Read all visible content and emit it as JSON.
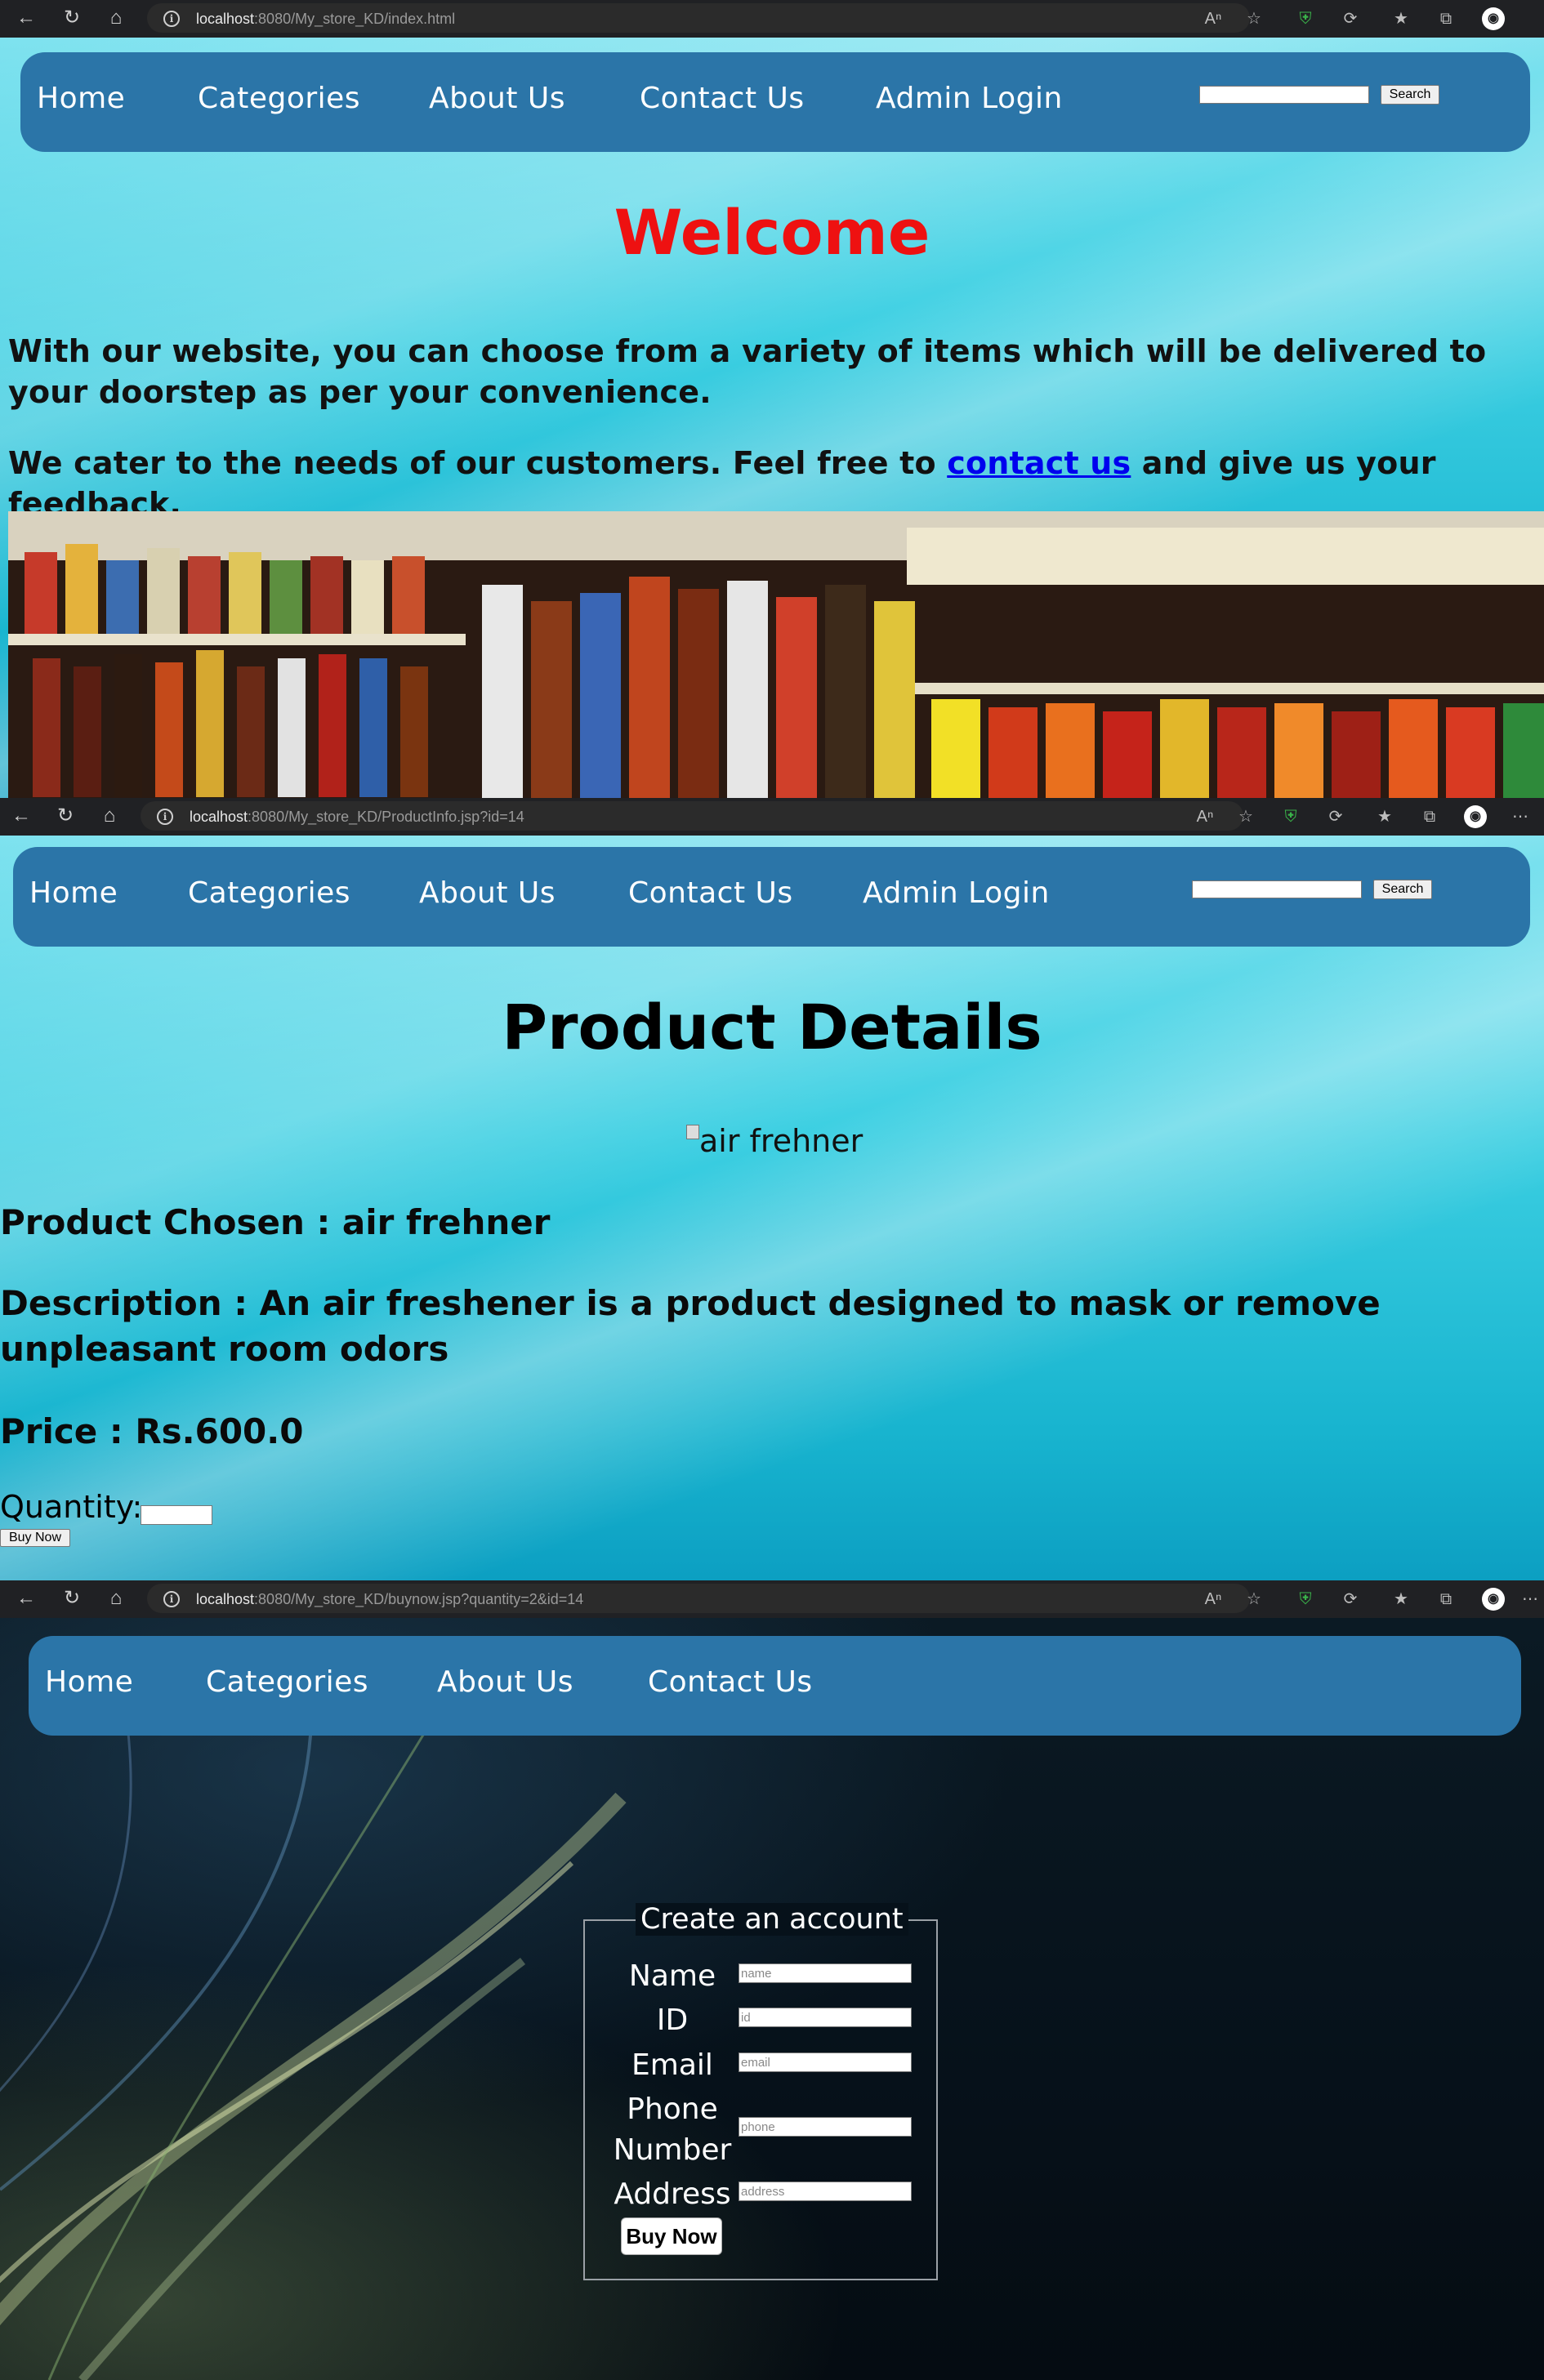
{
  "screens": [
    {
      "url_host": "localhost",
      "url_path": ":8080/My_store_KD/index.html"
    },
    {
      "url_host": "localhost",
      "url_path": ":8080/My_store_KD/ProductInfo.jsp?id=14"
    },
    {
      "url_host": "localhost",
      "url_path": ":8080/My_store_KD/buynow.jsp?quantity=2&id=14"
    }
  ],
  "nav": {
    "home": "Home",
    "categories": "Categories",
    "about": "About Us",
    "contact": "Contact Us",
    "admin": "Admin Login",
    "search_button": "Search"
  },
  "home_page": {
    "welcome": "Welcome",
    "para1": "With our website, you can choose from a variety of items which will be delivered to your doorstep as per your convenience.",
    "para2_before": "We cater to the needs of our customers. Feel free to ",
    "para2_link": "contact us",
    "para2_after": " and give us your feedback."
  },
  "product_page": {
    "title": "Product Details",
    "image_alt": "air frehner",
    "product_chosen": "Product Chosen : air frehner",
    "description": "Description : An air freshener is a product designed to mask or remove unpleasant room odors",
    "price": "Price : Rs.600.0",
    "quantity_label": "Quantity:",
    "buy_button": "Buy Now"
  },
  "account_form": {
    "legend": "Create an account",
    "fields": [
      {
        "label": "Name",
        "placeholder": "name"
      },
      {
        "label": "ID",
        "placeholder": "id"
      },
      {
        "label": "Email",
        "placeholder": "email"
      },
      {
        "label": "Phone Number",
        "placeholder": "phone"
      },
      {
        "label": "Address",
        "placeholder": "address"
      }
    ],
    "submit": "Buy Now"
  },
  "colors": {
    "nav_bg": "#2b75a8",
    "welcome_red": "#ee1111",
    "link_blue": "#0000ee"
  }
}
